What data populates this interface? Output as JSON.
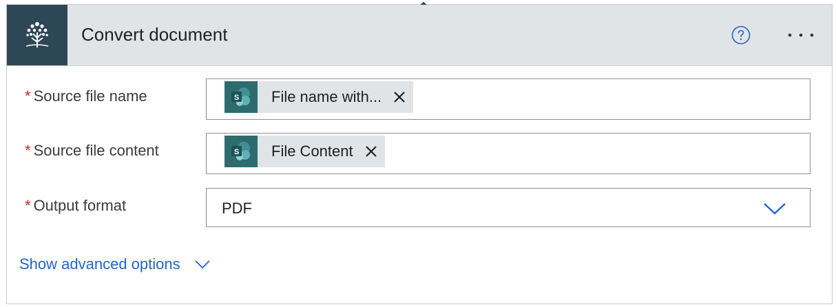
{
  "action": {
    "title": "Convert document",
    "logo_icon": "tree-icon",
    "help_icon": "help-icon",
    "more_icon": "more-options-icon"
  },
  "fields": [
    {
      "label": "Source file name",
      "required_mark": "*",
      "token": {
        "label": "File name with...",
        "icon": "sharepoint-icon"
      }
    },
    {
      "label": "Source file content",
      "required_mark": "*",
      "token": {
        "label": "File Content",
        "icon": "sharepoint-icon"
      }
    },
    {
      "label": "Output format",
      "required_mark": "*",
      "value": "PDF"
    }
  ],
  "advanced": {
    "label": "Show advanced options"
  },
  "colors": {
    "header_bg": "#e1e4e6",
    "logo_bg": "#2e4756",
    "sharepoint": "#2d6b6f",
    "link": "#2266c9",
    "required": "#c4262e"
  }
}
